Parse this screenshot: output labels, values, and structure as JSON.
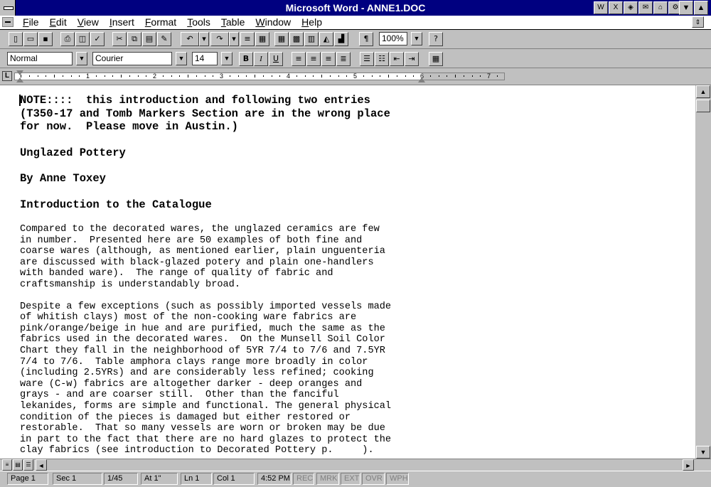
{
  "window": {
    "title": "Microsoft Word - ANNE1.DOC"
  },
  "menu": [
    "File",
    "Edit",
    "View",
    "Insert",
    "Format",
    "Tools",
    "Table",
    "Window",
    "Help"
  ],
  "formatting": {
    "style": "Normal",
    "font": "Courier",
    "size": "14",
    "bold": "B",
    "italic": "I",
    "underline": "U"
  },
  "toolbar": {
    "zoom": "100%",
    "pilcrow": "¶"
  },
  "ruler": {
    "numbers": [
      "1",
      "2",
      "3",
      "4",
      "5",
      "6",
      "7"
    ],
    "tab_selector": "L"
  },
  "document": {
    "note_lines": [
      "NOTE::::  this introduction and following two entries",
      "(T350-17 and Tomb Markers Section are in the wrong place",
      "for now.  Please move in Austin.)"
    ],
    "heading1": "Unglazed Pottery",
    "heading2": "By Anne Toxey",
    "heading3": "Introduction to the Catalogue",
    "para1": [
      "Compared to the decorated wares, the unglazed ceramics are few",
      "in number.  Presented here are 50 examples of both fine and",
      "coarse wares (although, as mentioned earlier, plain unguenteria",
      "are discussed with black-glazed potery and plain one-handlers",
      "with banded ware).  The range of quality of fabric and",
      "craftsmanship is understandably broad."
    ],
    "para2": [
      "Despite a few exceptions (such as possibly imported vessels made",
      "of whitish clays) most of the non-cooking ware fabrics are",
      "pink/orange/beige in hue and are purified, much the same as the",
      "fabrics used in the decorated wares.  On the Munsell Soil Color",
      "Chart they fall in the neighborhood of 5YR 7/4 to 7/6 and 7.5YR",
      "7/4 to 7/6.  Table amphora clays range more broadly in color",
      "(including 2.5YRs) and are considerably less refined; cooking",
      "ware (C-w) fabrics are altogether darker - deep oranges and",
      "grays - and are coarser still.  Other than the fanciful",
      "lekanides, forms are simple and functional. The general physical",
      "condition of the pieces is damaged but either restored or",
      "restorable.  That so many vessels are worn or broken may be due",
      "in part to the fact that there are no hard glazes to protect the",
      "clay fabrics (see introduction to Decorated Pottery p.     )."
    ]
  },
  "status": {
    "page": "Page 1",
    "sec": "Sec 1",
    "pages": "1/45",
    "at": "At 1\"",
    "ln": "Ln 1",
    "col": "Col 1",
    "time": "4:52 PM",
    "rec": "REC",
    "mrk": "MRK",
    "ext": "EXT",
    "ovr": "OVR",
    "wph": "WPH"
  }
}
